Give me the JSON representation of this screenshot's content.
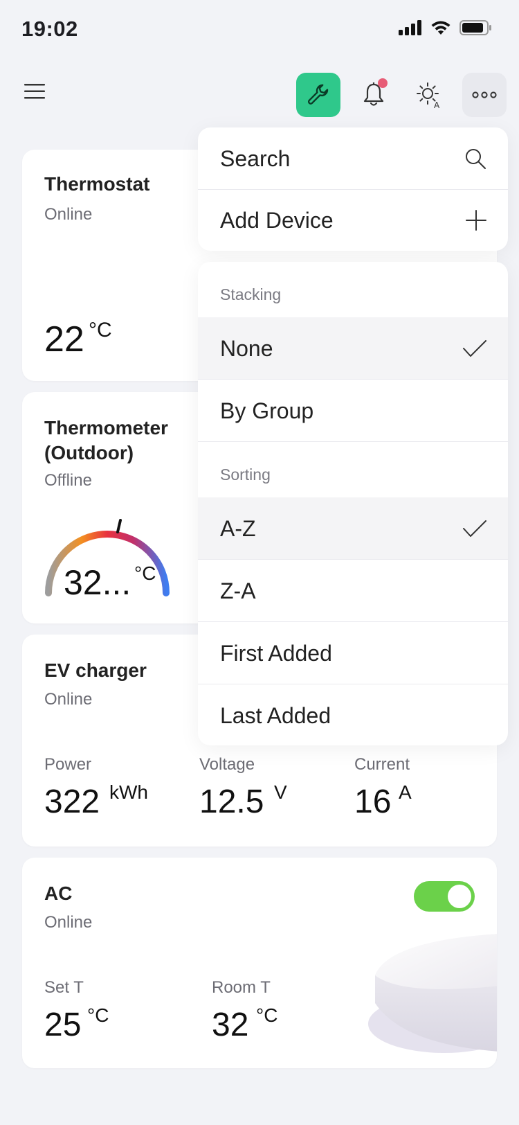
{
  "status_bar": {
    "time": "19:02"
  },
  "toolbar": {
    "menu_icon": "hamburger-icon",
    "wrench_icon": "wrench-icon",
    "bell_icon": "bell-icon",
    "theme_icon": "sun-auto-icon",
    "more_icon": "more-icon",
    "accent_color": "#2fc88b",
    "badge_color": "#e75c76"
  },
  "cards": {
    "thermostat": {
      "title": "Thermostat",
      "status": "Online",
      "value": "22",
      "unit": "°C"
    },
    "thermometer": {
      "title_line1": "Thermometer",
      "title_line2": "(Outdoor)",
      "status": "Offline",
      "value": "32...",
      "unit": "°C"
    },
    "ev_charger": {
      "title": "EV charger",
      "status": "Online",
      "metrics": [
        {
          "label": "Power",
          "value": "322",
          "unit": "kWh"
        },
        {
          "label": "Voltage",
          "value": "12.5",
          "unit": "V"
        },
        {
          "label": "Current",
          "value": "16",
          "unit": "A"
        }
      ]
    },
    "ac": {
      "title": "AC",
      "status": "Online",
      "toggle_on": true,
      "metrics": [
        {
          "label": "Set T",
          "value": "25",
          "unit": "°C"
        },
        {
          "label": "Room T",
          "value": "32",
          "unit": "°C"
        }
      ]
    }
  },
  "menu": {
    "actions": [
      {
        "label": "Search",
        "icon": "search-icon"
      },
      {
        "label": "Add Device",
        "icon": "plus-icon"
      }
    ],
    "stacking": {
      "label": "Stacking",
      "options": [
        {
          "label": "None",
          "selected": true
        },
        {
          "label": "By Group",
          "selected": false
        }
      ]
    },
    "sorting": {
      "label": "Sorting",
      "options": [
        {
          "label": "A-Z",
          "selected": true
        },
        {
          "label": "Z-A",
          "selected": false
        },
        {
          "label": "First Added",
          "selected": false
        },
        {
          "label": "Last Added",
          "selected": false
        }
      ]
    }
  }
}
